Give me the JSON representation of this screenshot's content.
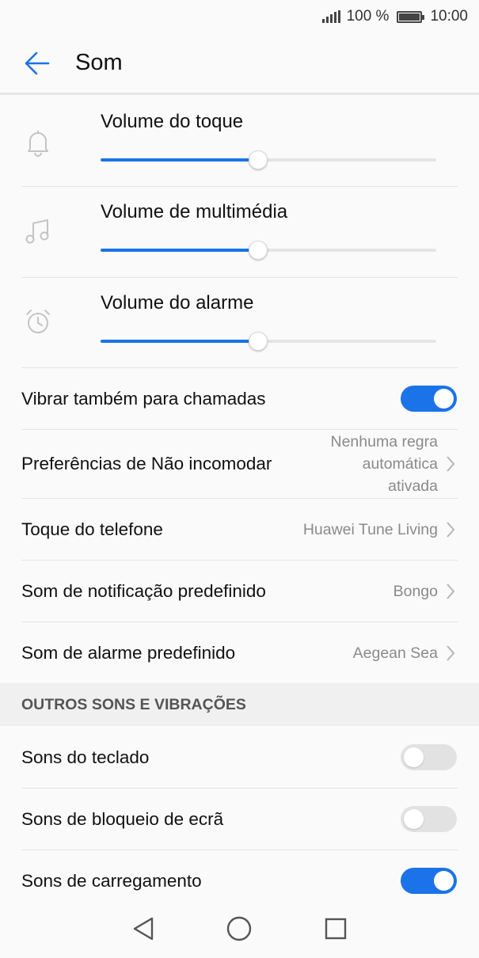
{
  "status_bar": {
    "battery_text": "100 %",
    "time": "10:00"
  },
  "header": {
    "title": "Som",
    "back_icon": "arrow-left-icon"
  },
  "volumes": [
    {
      "label": "Volume do toque",
      "icon": "bell-icon",
      "level": 0.47
    },
    {
      "label": "Volume de multimédia",
      "icon": "music-note-icon",
      "level": 0.47
    },
    {
      "label": "Volume do alarme",
      "icon": "alarm-clock-icon",
      "level": 0.47
    }
  ],
  "settings": {
    "vibrate_calls": {
      "label": "Vibrar também para chamadas",
      "on": true
    },
    "dnd": {
      "label": "Preferências de Não incomodar",
      "value_lines": [
        "Nenhuma regra",
        "automática",
        "ativada"
      ]
    },
    "ringtone": {
      "label": "Toque do telefone",
      "value": "Huawei Tune Living"
    },
    "notification_sound": {
      "label": "Som de notificação predefinido",
      "value": "Bongo"
    },
    "alarm_sound": {
      "label": "Som de alarme predefinido",
      "value": "Aegean Sea"
    }
  },
  "other_section": {
    "title": "OUTROS SONS E VIBRAÇÕES",
    "keyboard_sounds": {
      "label": "Sons do teclado",
      "on": false
    },
    "lock_sounds": {
      "label": "Sons de bloqueio de ecrã",
      "on": false
    },
    "charging_sounds": {
      "label": "Sons de carregamento",
      "on": true
    }
  },
  "colors": {
    "accent": "#1a73e8",
    "icon_gray": "#c4c4c4",
    "value_gray": "#8a8a8a"
  }
}
